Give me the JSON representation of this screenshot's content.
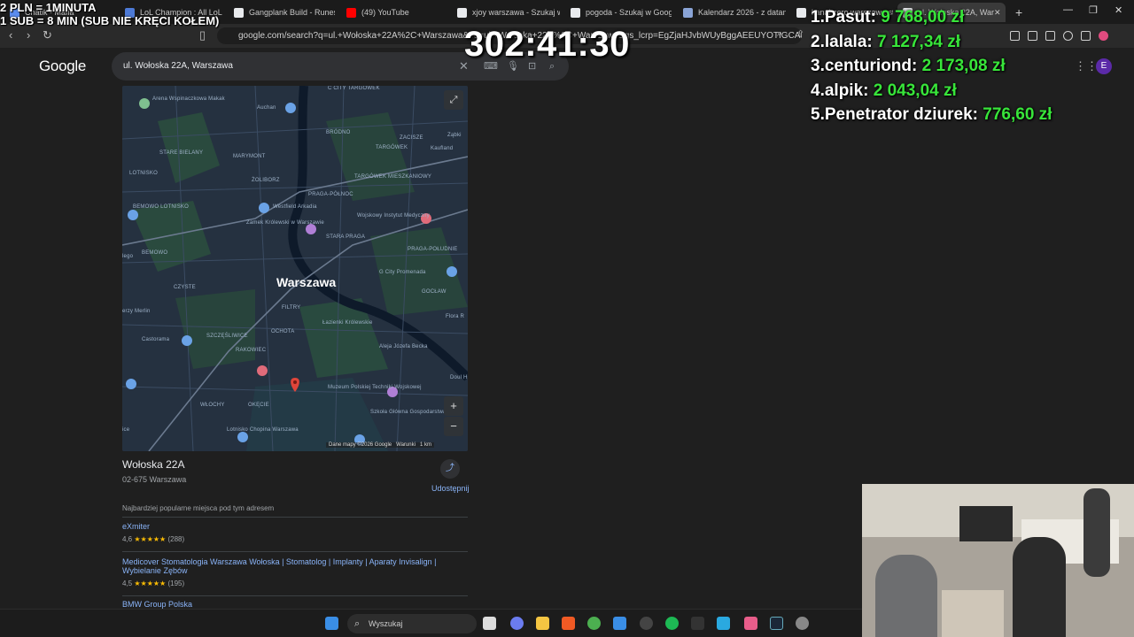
{
  "tabs": [
    {
      "label": "Chatik - Mafia",
      "color": "#5b8def"
    },
    {
      "label": "LoL Champion : All LoL Ch",
      "color": "#4d7ad6"
    },
    {
      "label": "Gangplank Build - Runes &",
      "color": "#e8eaed"
    },
    {
      "label": "(49) YouTube",
      "color": "#ff0000"
    },
    {
      "label": "xjoy warszawa - Szukaj w G",
      "color": "#e8eaed"
    },
    {
      "label": "pogoda - Szukaj w Google",
      "color": "#e8eaed"
    },
    {
      "label": "Kalendarz 2026 - z datam",
      "color": "#8aa4d6"
    },
    {
      "label": "kanal zero warszawa studi",
      "color": "#e8eaed"
    },
    {
      "label": "ul. Wołoska 22A, War",
      "color": "#e8eaed",
      "active": true
    }
  ],
  "address_bar": {
    "url": "google.com/search?q=ul.+Wołoska+22A%2C+Warszawa&oq=ul.+Wołoska+22A%2C+Warszawa&gs_lcrp=EgZjaHJvbWUyBggAEEUYOTIGCAEQ..."
  },
  "google": {
    "logo": "Google",
    "search_query": "ul. Wołoska 22A, Warszawa"
  },
  "map": {
    "city_label": "Warszawa",
    "labels": [
      {
        "text": "C CITY TARGÓWEK",
        "cls": "a"
      },
      {
        "text": "Arena Wspinaczkowa Makak",
        "cls": "b"
      },
      {
        "text": "Auchan",
        "cls": "c"
      },
      {
        "text": "BRÓDNO",
        "cls": "d"
      },
      {
        "text": "Ząbki",
        "cls": "e"
      },
      {
        "text": "Kaufland",
        "cls": "f"
      },
      {
        "text": "ZACISZE",
        "cls": "g"
      },
      {
        "text": "TARGÓWEK",
        "cls": "h"
      },
      {
        "text": "STARE BIELANY",
        "cls": "i"
      },
      {
        "text": "MARYMONT",
        "cls": "j"
      },
      {
        "text": "LOTNISKO",
        "cls": "k"
      },
      {
        "text": "ŻOLIBORZ",
        "cls": "l"
      },
      {
        "text": "TARGÓWEK MIESZKANIOWY",
        "cls": "m"
      },
      {
        "text": "PRAGA-PÓŁNOC",
        "cls": "n"
      },
      {
        "text": "Westfield Arkadia",
        "cls": "o"
      },
      {
        "text": "BEMOWO LOTNISKO",
        "cls": "p"
      },
      {
        "text": "Zamek Królewski w Warszawie",
        "cls": "q"
      },
      {
        "text": "STARA PRAGA",
        "cls": "r"
      },
      {
        "text": "Wojskowy Instytut Medyczny",
        "cls": "s"
      },
      {
        "text": "BEMOWO",
        "cls": "t"
      },
      {
        "text": "PRAGA-POŁUDNIE",
        "cls": "u"
      },
      {
        "text": "lego",
        "cls": "v"
      },
      {
        "text": "G City Promenada",
        "cls": "w"
      },
      {
        "text": "GOCŁAW",
        "cls": "x"
      },
      {
        "text": "CZYSTE",
        "cls": "y"
      },
      {
        "text": "FILTRY",
        "cls": "z"
      },
      {
        "text": "erzy Merlin",
        "cls": "aa"
      },
      {
        "text": "Łazienki Królewskie",
        "cls": "ab"
      },
      {
        "text": "Flora R",
        "cls": "ac"
      },
      {
        "text": "OCHOTA",
        "cls": "ad"
      },
      {
        "text": "Castorama",
        "cls": "ae"
      },
      {
        "text": "SZCZĘŚLIWICE",
        "cls": "af"
      },
      {
        "text": "RAKOWIEC",
        "cls": "ag"
      },
      {
        "text": "Aleja Józefa Becka",
        "cls": "ah"
      },
      {
        "text": "Doul Hilto",
        "cls": "ai"
      },
      {
        "text": "Muzeum Polskiej Techniki Wojskowej",
        "cls": "aj"
      },
      {
        "text": "WŁOCHY",
        "cls": "ak"
      },
      {
        "text": "OKĘCIE",
        "cls": "al"
      },
      {
        "text": "Lotnisko Chopina Warszawa",
        "cls": "am"
      },
      {
        "text": "Szkoła Główna Gospodarstwa",
        "cls": "an"
      },
      {
        "text": "ice",
        "cls": "ao"
      }
    ],
    "attribution": "Dane mapy ©2026 Google",
    "terms": "Warunki",
    "scale": "1 km"
  },
  "place": {
    "title": "Wołoska 22A",
    "subtitle": "02-675 Warszawa",
    "share_label": "Udostępnij",
    "section_header": "Najbardziej popularne miejsca pod tym adresem",
    "results": [
      {
        "name": "eXmiter",
        "rating": "4,6",
        "stars": "★★★★★",
        "count": "(288)"
      },
      {
        "name": "Medicover Stomatologia Warszawa Wołoska | Stomatolog | Implanty | Aparaty Invisalign | Wybielanie Zębów",
        "rating": "4,5",
        "stars": "★★★★★",
        "count": "(195)"
      },
      {
        "name": "BMW Group Polska"
      }
    ]
  },
  "overlay": {
    "line1": "2 PLN = 1MINUTA",
    "line2": "1 SUB = 8 MIN (SUB NIE KRĘCI KOŁEM)",
    "timer": "302:41:30",
    "leaderboard": [
      {
        "rank": "1.",
        "name": "Pasut:",
        "amount": "9 768,00 zł"
      },
      {
        "rank": "2.",
        "name": "lalala:",
        "amount": "7 127,34 zł"
      },
      {
        "rank": "3.",
        "name": "centuriond:",
        "amount": "2 173,08 zł"
      },
      {
        "rank": "4.",
        "name": "alpik:",
        "amount": "2 043,04 zł"
      },
      {
        "rank": "5.",
        "name": "Penetrator dziurek:",
        "amount": "776,60 zł"
      }
    ]
  },
  "taskbar": {
    "search_placeholder": "Wyszukaj",
    "avatar_letter": "E"
  }
}
